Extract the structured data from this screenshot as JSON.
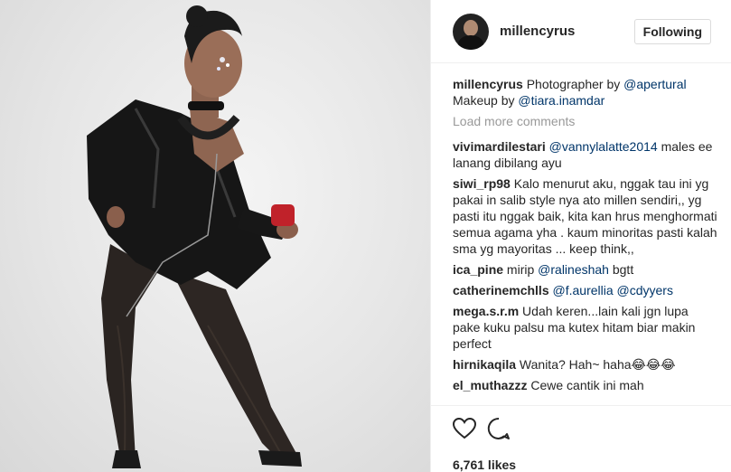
{
  "post": {
    "username": "millencyrus",
    "follow_button": "Following",
    "caption": {
      "username": "millencyrus",
      "text_before_mention1": " Photographer by ",
      "mention1": "@apertural",
      "text_line2": "Makeup by ",
      "mention2": "@tiara.inamdar"
    },
    "load_more": "Load more comments",
    "comments": [
      {
        "user": "vivimardilestari",
        "mention": "@vannylalatte2014",
        "text": " males ee lanang dibilang ayu"
      },
      {
        "user": "siwi_rp98",
        "mention": "",
        "text": " Kalo menurut aku, nggak tau ini yg pakai in salib style nya ato millen sendiri,, yg pasti itu nggak baik, kita kan hrus menghormati semua agama yha . kaum minoritas pasti kalah sma yg mayoritas ... keep think,,"
      },
      {
        "user": "ica_pine",
        "text_before": " mirip ",
        "mention": "@ralineshah",
        "text": " bgtt"
      },
      {
        "user": "catherinemchlls",
        "mention": "@f.aurellia @cdyyers",
        "text": ""
      },
      {
        "user": "mega.s.r.m",
        "mention": "",
        "text": " Udah keren...lain kali jgn lupa pake kuku palsu ma kutex hitam biar makin perfect"
      },
      {
        "user": "hirnikaqila",
        "mention": "",
        "text": " Wanita? Hah~ haha😂😂😂"
      },
      {
        "user": "el_muthazzz",
        "mention": "",
        "text": " Cewe cantik ini mah"
      }
    ],
    "likes": "6,761 likes",
    "icons": {
      "like": "heart-icon",
      "comment": "comment-bubble-icon"
    }
  }
}
